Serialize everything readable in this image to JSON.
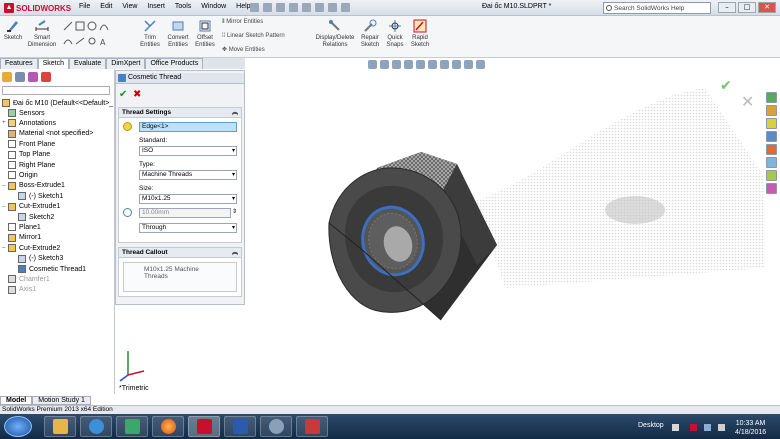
{
  "app": {
    "logo": "SOLIDWORKS",
    "document_title": "Đai ốc M10.SLDPRT *",
    "menu": [
      "File",
      "Edit",
      "View",
      "Insert",
      "Tools",
      "Window",
      "Help"
    ],
    "help_search_placeholder": "Search SolidWorks Help",
    "window_controls": [
      "–",
      "□",
      "✕"
    ]
  },
  "command_manager": {
    "big": [
      "Sketch",
      "Smart Dimension",
      "Trim Entities",
      "Convert Entities",
      "Offset Entities",
      "Display/Delete Relations",
      "Repair Sketch",
      "Quick Snaps",
      "Rapid Sketch"
    ],
    "small": [
      "Mirror Entities",
      "Linear Sketch Pattern",
      "Move Entities"
    ]
  },
  "tabs": [
    "Features",
    "Sketch",
    "Evaluate",
    "DimXpert",
    "Office Products"
  ],
  "active_tab": "Sketch",
  "tree": {
    "root": "Đai ốc M10  (Default<<Default>_",
    "items": [
      {
        "label": "Sensors",
        "level": 1,
        "expander": ""
      },
      {
        "label": "Annotations",
        "level": 1,
        "expander": "+"
      },
      {
        "label": "Material <not specified>",
        "level": 1,
        "expander": ""
      },
      {
        "label": "Front Plane",
        "level": 1,
        "expander": ""
      },
      {
        "label": "Top Plane",
        "level": 1,
        "expander": ""
      },
      {
        "label": "Right Plane",
        "level": 1,
        "expander": ""
      },
      {
        "label": "Origin",
        "level": 1,
        "expander": ""
      },
      {
        "label": "Boss-Extrude1",
        "level": 1,
        "expander": "–"
      },
      {
        "label": "(-) Sketch1",
        "level": 2,
        "expander": ""
      },
      {
        "label": "Cut-Extrude1",
        "level": 1,
        "expander": "–"
      },
      {
        "label": "Sketch2",
        "level": 2,
        "expander": ""
      },
      {
        "label": "Plane1",
        "level": 1,
        "expander": ""
      },
      {
        "label": "Mirror1",
        "level": 1,
        "expander": ""
      },
      {
        "label": "Cut-Extrude2",
        "level": 1,
        "expander": "–"
      },
      {
        "label": "(-) Sketch3",
        "level": 2,
        "expander": ""
      },
      {
        "label": "Cosmetic Thread1",
        "level": 2,
        "expander": ""
      },
      {
        "label": "Chamfer1",
        "level": 1,
        "expander": "",
        "suppressed": true
      },
      {
        "label": "Axis1",
        "level": 1,
        "expander": "",
        "suppressed": true
      }
    ]
  },
  "property_manager": {
    "title": "Cosmetic Thread",
    "thread_settings": {
      "header": "Thread Settings",
      "edge": "Edge<1>",
      "standard_label": "Standard:",
      "standard": "ISO",
      "type_label": "Type:",
      "type": "Machine Threads",
      "size_label": "Size:",
      "size": "M10x1.25",
      "diameter": "10.00mm",
      "end_condition": "Through"
    },
    "thread_callout": {
      "header": "Thread Callout",
      "text": "M10x1.25 Machine Threads"
    }
  },
  "viewport": {
    "view_label": "*Trimetric",
    "nut_color": "#4a4a4a",
    "thread_color": "#3a6fc4"
  },
  "bottom_tabs": [
    "Model",
    "Motion Study 1"
  ],
  "status_bar": "SolidWorks Premium 2013 x64 Edition",
  "taskbar": {
    "desktop_label": "Desktop",
    "time": "10:33 AM",
    "date": "4/18/2016"
  }
}
